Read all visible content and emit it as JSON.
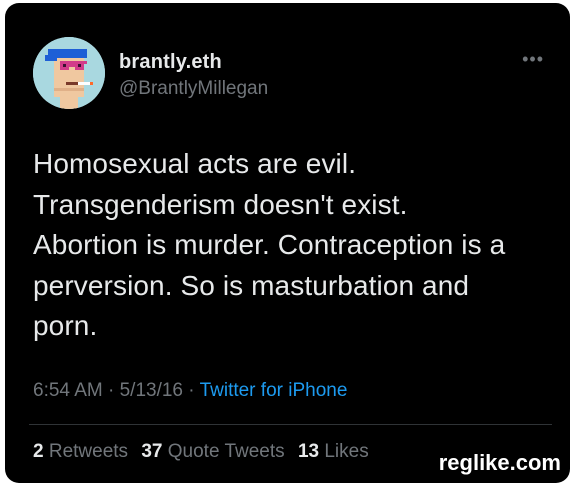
{
  "user": {
    "name": "brantly.eth",
    "handle": "@BrantlyMillegan"
  },
  "more_label": "•••",
  "tweet": {
    "lines": [
      "Homosexual acts are evil.",
      "Transgenderism doesn't exist.",
      "Abortion is murder. Contraception is a",
      "perversion. So is masturbation and",
      "porn."
    ]
  },
  "meta": {
    "time": "6:54 AM",
    "sep1": " · ",
    "date": "5/13/16",
    "sep2": " · ",
    "source": "Twitter for iPhone"
  },
  "stats": {
    "retweets_count": "2",
    "retweets_label": "Retweets",
    "quotes_count": "37",
    "quotes_label": "Quote Tweets",
    "likes_count": "13",
    "likes_label": "Likes"
  },
  "watermark": "reglike.com",
  "colors": {
    "background": "#000000",
    "text": "#e7e9ea",
    "muted": "#71767b",
    "link": "#1d9bf0"
  }
}
